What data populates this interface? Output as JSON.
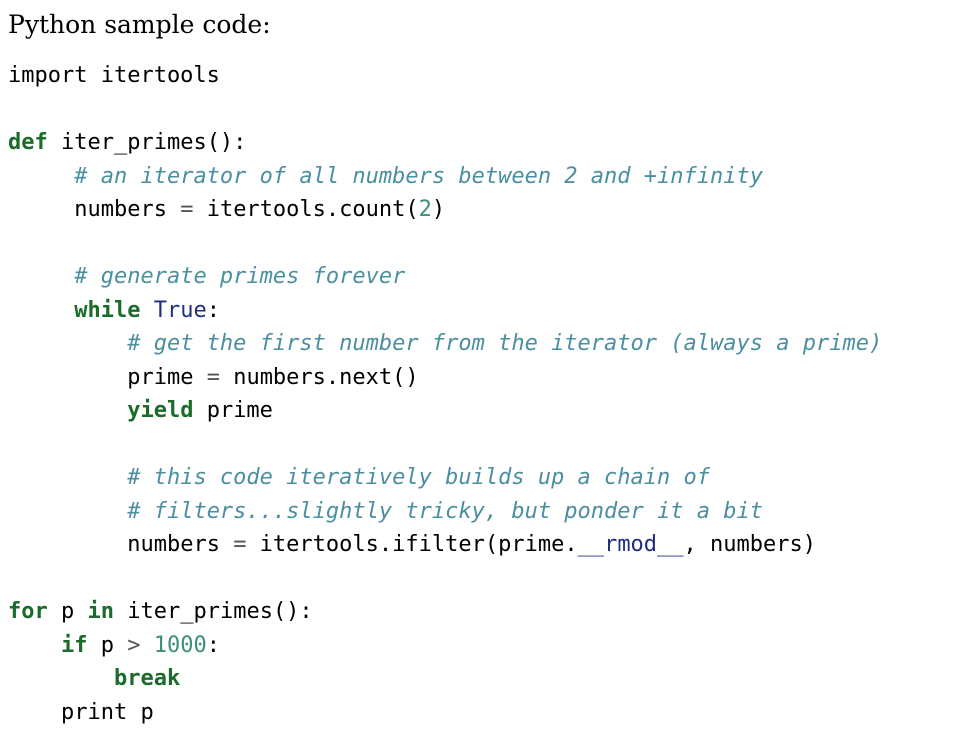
{
  "document": {
    "intro": "Python sample code:",
    "code": {
      "language": "Python",
      "lines": [
        {
          "indent": 0,
          "tokens": [
            {
              "text": "import itertools",
              "kind": "plain"
            }
          ]
        },
        {
          "indent": 0,
          "tokens": []
        },
        {
          "indent": 0,
          "tokens": [
            {
              "text": "def",
              "kind": "keyword"
            },
            {
              "text": " iter_primes():",
              "kind": "plain"
            }
          ]
        },
        {
          "indent": 5,
          "tokens": [
            {
              "text": "# an iterator of all numbers between 2 and +infinity",
              "kind": "comment"
            }
          ]
        },
        {
          "indent": 5,
          "tokens": [
            {
              "text": "numbers ",
              "kind": "plain"
            },
            {
              "text": "=",
              "kind": "operator"
            },
            {
              "text": " itertools.count(",
              "kind": "plain"
            },
            {
              "text": "2",
              "kind": "number"
            },
            {
              "text": ")",
              "kind": "plain"
            }
          ]
        },
        {
          "indent": 0,
          "tokens": []
        },
        {
          "indent": 5,
          "tokens": [
            {
              "text": "# generate primes forever",
              "kind": "comment"
            }
          ]
        },
        {
          "indent": 5,
          "tokens": [
            {
              "text": "while",
              "kind": "keyword"
            },
            {
              "text": " ",
              "kind": "plain"
            },
            {
              "text": "True",
              "kind": "builtin"
            },
            {
              "text": ":",
              "kind": "plain"
            }
          ]
        },
        {
          "indent": 9,
          "tokens": [
            {
              "text": "# get the first number from the iterator (always a prime)",
              "kind": "comment"
            }
          ]
        },
        {
          "indent": 9,
          "tokens": [
            {
              "text": "prime ",
              "kind": "plain"
            },
            {
              "text": "=",
              "kind": "operator"
            },
            {
              "text": " numbers.next()",
              "kind": "plain"
            }
          ]
        },
        {
          "indent": 9,
          "tokens": [
            {
              "text": "yield",
              "kind": "keyword"
            },
            {
              "text": " prime",
              "kind": "plain"
            }
          ]
        },
        {
          "indent": 0,
          "tokens": []
        },
        {
          "indent": 9,
          "tokens": [
            {
              "text": "# this code iteratively builds up a chain of",
              "kind": "comment"
            }
          ]
        },
        {
          "indent": 9,
          "tokens": [
            {
              "text": "# filters...slightly tricky, but ponder it a bit",
              "kind": "comment"
            }
          ]
        },
        {
          "indent": 9,
          "tokens": [
            {
              "text": "numbers ",
              "kind": "plain"
            },
            {
              "text": "=",
              "kind": "operator"
            },
            {
              "text": " itertools.ifilter(prime.",
              "kind": "plain"
            },
            {
              "text": "__rmod__",
              "kind": "special"
            },
            {
              "text": ", numbers)",
              "kind": "plain"
            }
          ]
        },
        {
          "indent": 0,
          "tokens": []
        },
        {
          "indent": 0,
          "tokens": [
            {
              "text": "for",
              "kind": "keyword"
            },
            {
              "text": " p ",
              "kind": "plain"
            },
            {
              "text": "in",
              "kind": "keyword"
            },
            {
              "text": " iter_primes():",
              "kind": "plain"
            }
          ]
        },
        {
          "indent": 4,
          "tokens": [
            {
              "text": "if",
              "kind": "keyword"
            },
            {
              "text": " p ",
              "kind": "plain"
            },
            {
              "text": ">",
              "kind": "operator"
            },
            {
              "text": " ",
              "kind": "plain"
            },
            {
              "text": "1000",
              "kind": "number"
            },
            {
              "text": ":",
              "kind": "plain"
            }
          ]
        },
        {
          "indent": 8,
          "tokens": [
            {
              "text": "break",
              "kind": "keyword"
            }
          ]
        },
        {
          "indent": 4,
          "tokens": [
            {
              "text": "print p",
              "kind": "plain"
            }
          ]
        }
      ]
    }
  },
  "colors": {
    "background": "#ffffff",
    "plain": "#000000",
    "keyword": "#1b6c2a",
    "builtin": "#1f2f7f",
    "number": "#3d8f7a",
    "operator": "#555555",
    "comment": "#4b8fa0",
    "special": "#1f2f7f"
  }
}
